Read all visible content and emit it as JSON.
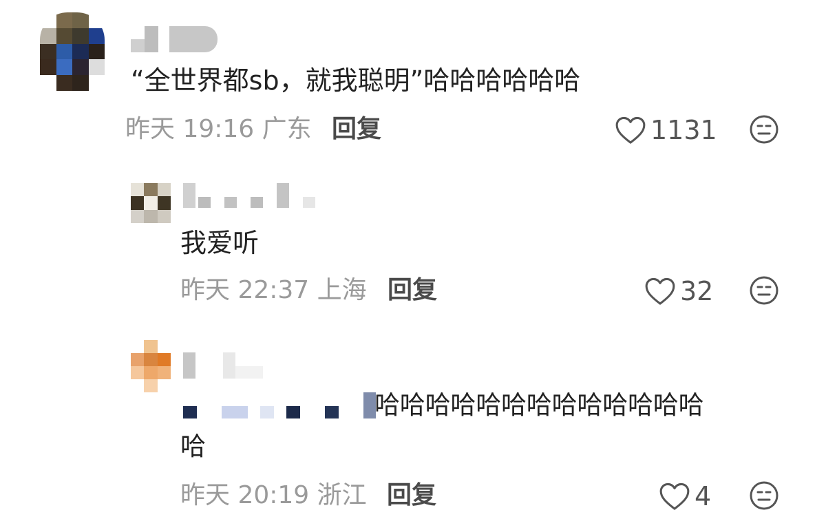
{
  "comments": [
    {
      "text": "“全世界都sb，就我聪明”哈哈哈哈哈哈",
      "time": "昨天 19:16",
      "location": "广东",
      "reply_label": "回复",
      "likes": "1131"
    },
    {
      "text": "我爱听",
      "time": "昨天 22:37",
      "location": "上海",
      "reply_label": "回复",
      "likes": "32"
    },
    {
      "text_line1": "哈哈哈哈哈哈哈哈哈哈哈哈哈",
      "text_line2": "哈",
      "time": "昨天 20:19",
      "location": "浙江",
      "reply_label": "回复",
      "likes": "4"
    }
  ],
  "icons": {
    "like": "heart-outline-icon",
    "dislike": "meh-face-icon"
  },
  "colors": {
    "text": "#222222",
    "meta": "#9a9a9a",
    "reply": "#4a4a4a",
    "icon": "#555555"
  }
}
